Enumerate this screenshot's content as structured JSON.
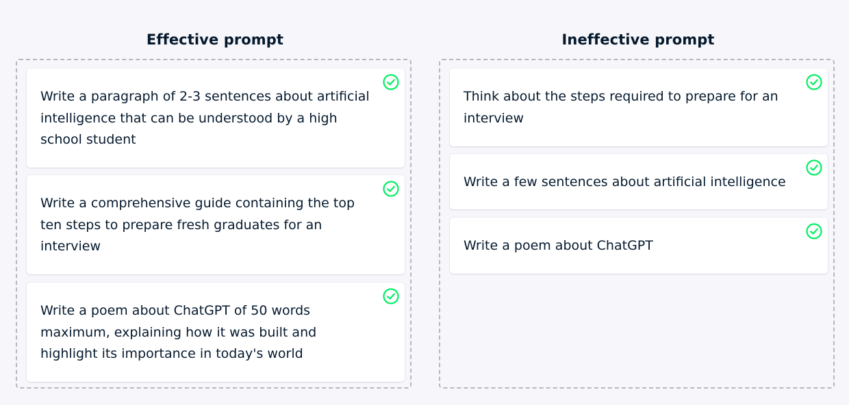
{
  "effective": {
    "title": "Effective prompt",
    "cards": [
      {
        "text": "Write a paragraph of 2-3 sentences about artificial intelligence that can be understood by a high school student",
        "status": "correct"
      },
      {
        "text": "Write a comprehensive guide containing the top ten steps to prepare fresh graduates for an interview",
        "status": "correct"
      },
      {
        "text": "Write a poem about ChatGPT of 50 words maximum, explaining how it was built and highlight its importance in today's world",
        "status": "correct"
      }
    ]
  },
  "ineffective": {
    "title": "Ineffective prompt",
    "cards": [
      {
        "text": "Think about the steps required to prepare for an interview",
        "status": "correct"
      },
      {
        "text": "Write a few sentences about artificial intelligence",
        "status": "correct"
      },
      {
        "text": "Write a poem about ChatGPT",
        "status": "correct"
      }
    ]
  },
  "colors": {
    "background": "#f6f6fb",
    "text": "#05192d",
    "correct_check": "#03ef62",
    "dashed_border": "#b7b7c0",
    "card": "#ffffff"
  },
  "icons": {
    "card_status": "check-circle-icon"
  }
}
